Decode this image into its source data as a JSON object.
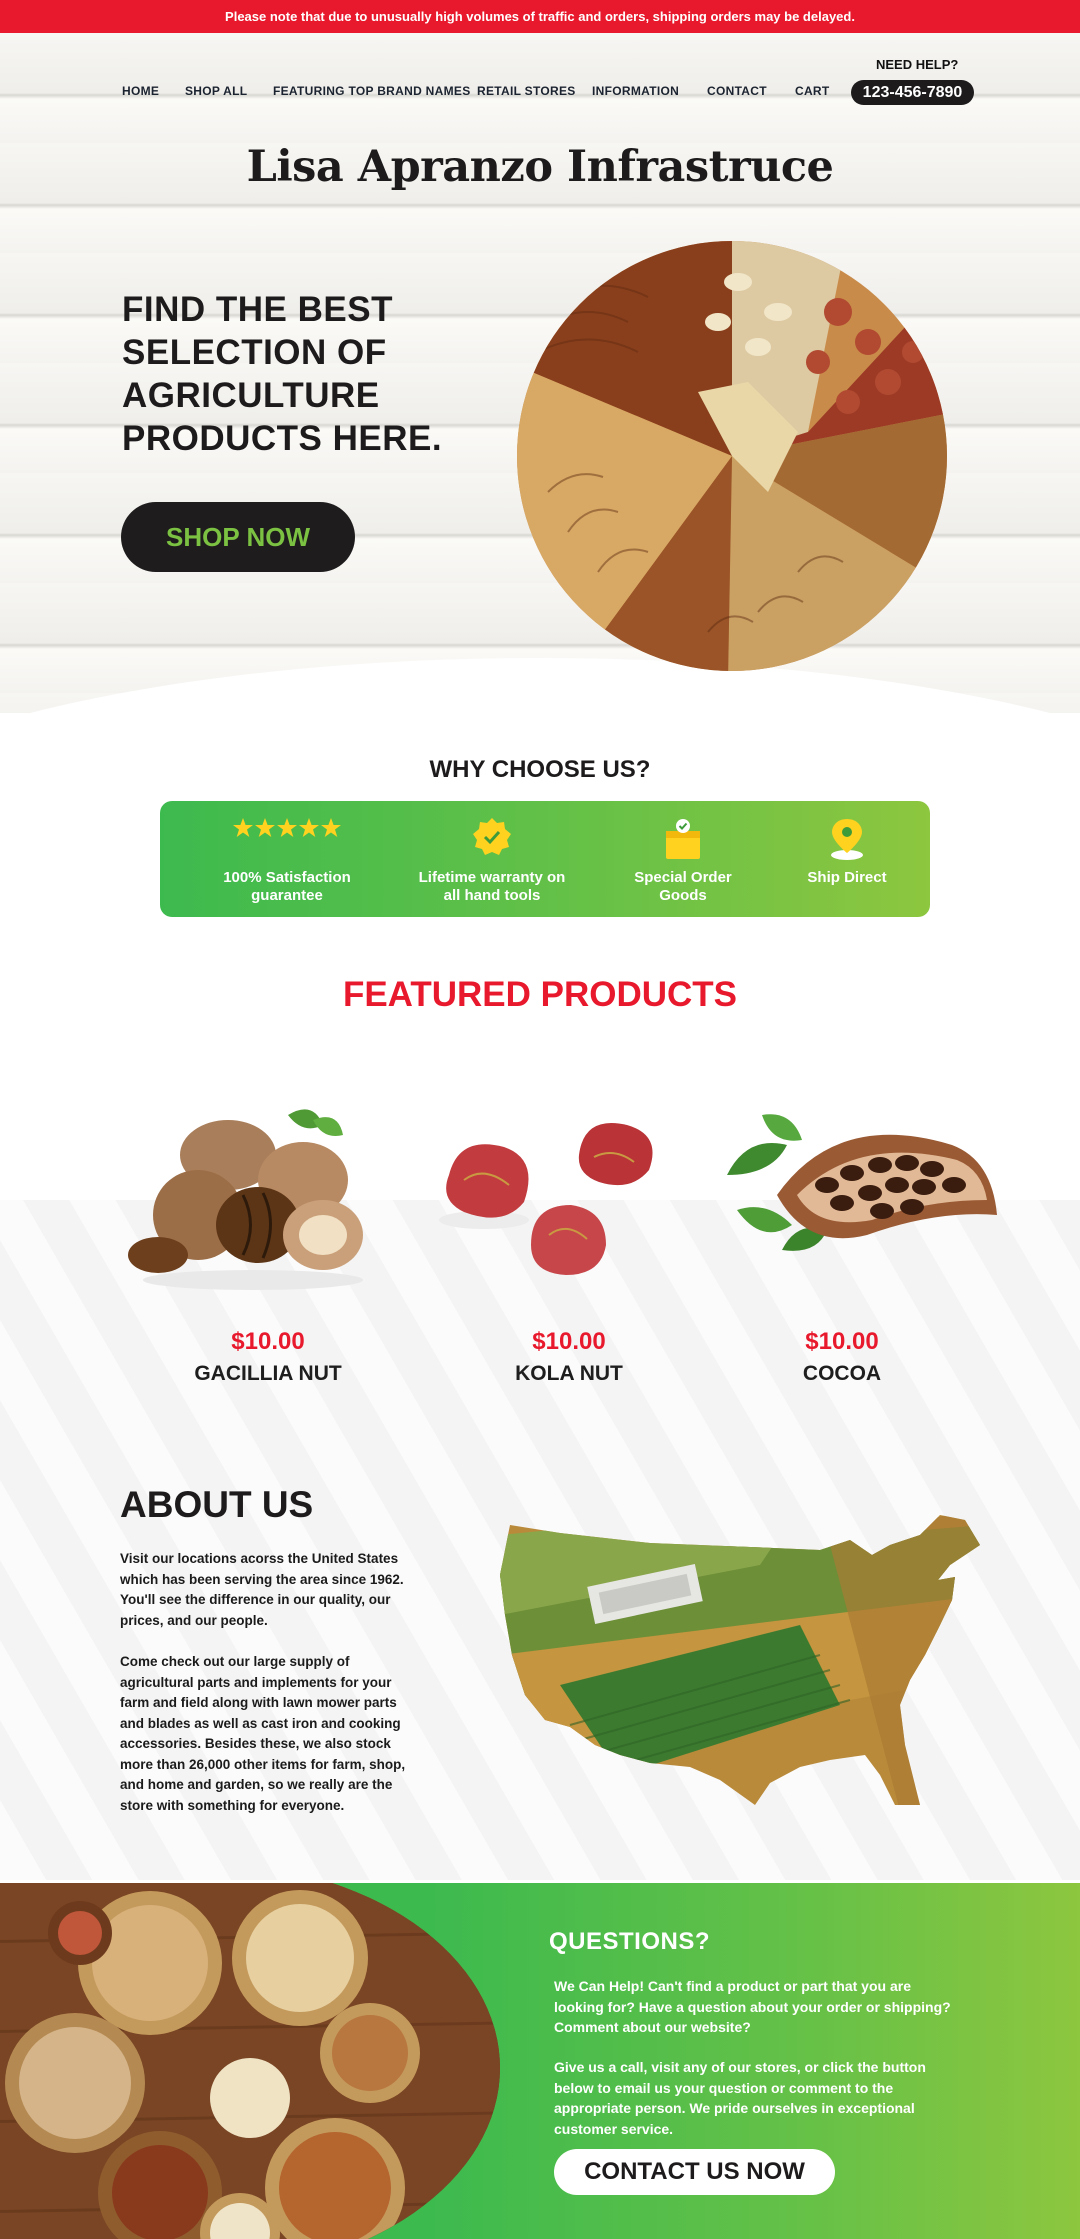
{
  "banner": {
    "text": "Please note that due to unusually high volumes of traffic and orders, shipping orders may be delayed."
  },
  "nav": {
    "items": [
      "HOME",
      "SHOP ALL",
      "FEATURING TOP BRAND NAMES",
      "RETAIL STORES",
      "INFORMATION",
      "CONTACT",
      "CART"
    ],
    "need_help": "NEED HELP?",
    "phone": "123-456-7890"
  },
  "site_title": "Lisa Apranzo Infrastruce",
  "hero": {
    "heading_lines": [
      "FIND THE BEST",
      "SELECTION OF",
      "AGRICULTURE",
      "PRODUCTS HERE."
    ],
    "cta": "SHOP NOW"
  },
  "why": {
    "title": "WHY CHOOSE US?",
    "items": [
      {
        "icon": "five-stars-icon",
        "label_lines": [
          "100% Satisfaction",
          "guarantee"
        ]
      },
      {
        "icon": "verified-badge-icon",
        "label_lines": [
          "Lifetime warranty on",
          "all hand tools"
        ]
      },
      {
        "icon": "special-order-box-icon",
        "label_lines": [
          "Special Order",
          "Goods"
        ]
      },
      {
        "icon": "location-pin-icon",
        "label_lines": [
          "Ship Direct",
          ""
        ]
      }
    ]
  },
  "featured": {
    "title": "FEATURED PRODUCTS",
    "products": [
      {
        "price": "$10.00",
        "name": "GACILLIA NUT"
      },
      {
        "price": "$10.00",
        "name": "KOLA NUT"
      },
      {
        "price": "$10.00",
        "name": "COCOA"
      }
    ]
  },
  "about": {
    "title": "ABOUT US",
    "p1": "Visit our locations acorss the United States which has been serving the area since 1962. You'll see the difference in our quality, our prices, and our people.",
    "p2": "Come check out our large supply of agricultural parts and implements for your farm and field along with lawn mower parts and blades as well as cast iron and cooking accessories. Besides these, we also stock more than 26,000 other items for farm, shop, and home and garden, so we really are the store with something for everyone."
  },
  "questions": {
    "title": "QUESTIONS?",
    "p1": "We Can Help! Can't find a product or part that you are looking for? Have a question about your order or shipping? Comment about our website?",
    "p2": "Give us a call, visit any of our stores, or click the button below to email us your question or comment to the appropriate person. We pride ourselves in exceptional customer service.",
    "cta": "CONTACT US NOW"
  },
  "colors": {
    "accent_red": "#e8192c",
    "accent_green": "#7cc242",
    "dark": "#1d1b1c"
  }
}
